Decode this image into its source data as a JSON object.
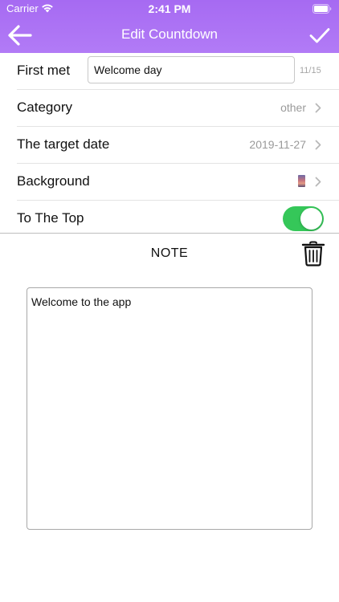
{
  "status_bar": {
    "carrier": "Carrier",
    "time": "2:41 PM"
  },
  "nav": {
    "title": "Edit Countdown",
    "back_icon": "arrow-left-icon",
    "done_icon": "checkmark-icon"
  },
  "form": {
    "name": {
      "label": "First met",
      "value": "Welcome day",
      "count": "11/15"
    },
    "category": {
      "label": "Category",
      "value": "other"
    },
    "target_date": {
      "label": "The target date",
      "value": "2019-11-27"
    },
    "background": {
      "label": "Background"
    },
    "to_top": {
      "label": "To The Top",
      "enabled": true
    }
  },
  "note": {
    "title": "NOTE",
    "text": "Welcome to the app"
  },
  "colors": {
    "header_gradient_top": "#a66af2",
    "header_gradient_bottom": "#b27bf6",
    "toggle_on": "#35c759",
    "secondary_text": "#9a9a9a"
  }
}
